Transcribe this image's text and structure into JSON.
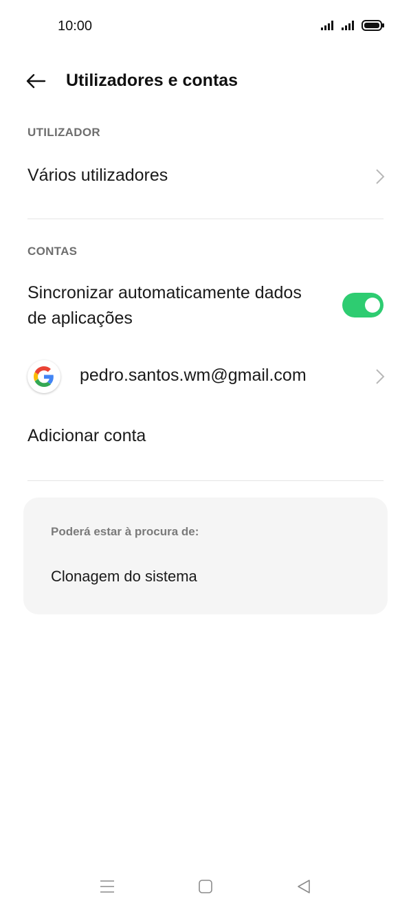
{
  "status_bar": {
    "time": "10:00",
    "icons": [
      "signal-icon",
      "signal-icon",
      "battery-icon"
    ]
  },
  "header": {
    "title": "Utilizadores e contas",
    "back_icon": "arrow-left-icon"
  },
  "sections": {
    "user": {
      "header": "UTILIZADOR",
      "items": [
        {
          "label": "Vários utilizadores"
        }
      ]
    },
    "accounts": {
      "header": "CONTAS",
      "auto_sync_label_line1": "Sincronizar automaticamente dados",
      "auto_sync_label_line2": "de aplicações",
      "auto_sync_enabled": true,
      "account_email": "pedro.santos.wm@gmail.com",
      "add_account_label": "Adicionar conta"
    }
  },
  "suggestions": {
    "title": "Poderá estar à procura de:",
    "items": [
      "Clonagem do sistema"
    ]
  },
  "nav_bar": {
    "icons": [
      "menu-icon",
      "home-icon",
      "back-icon"
    ]
  },
  "colors": {
    "accent": "#2ecc71",
    "card_background": "#f5f5f5",
    "section_header": "#6e6e6e"
  }
}
